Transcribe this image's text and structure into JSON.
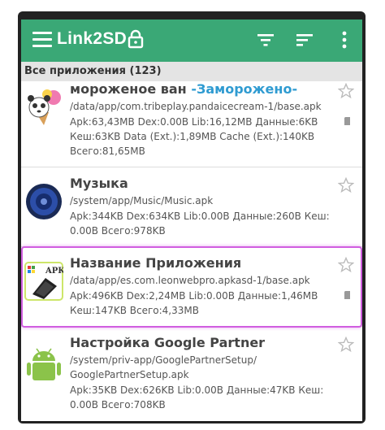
{
  "appbar": {
    "title": "Link2SD",
    "bg_color": "#3aa876"
  },
  "section": {
    "label": "Все приложения (123)"
  },
  "apps": [
    {
      "name": "мороженое ван",
      "frozen_tag": "-Заморожено-",
      "path": "/data/app/com.tribeplay.pandaicecream-1/base.apk",
      "line1": "Apk:63,43MB  Dex:0.00B  Lib:16,12MB  Данные:6KB",
      "line2": "Кеш:63KB  Data (Ext.):1,89MB  Cache (Ext.):140KB",
      "line3": "Всего:81,65MB",
      "icon": "panda-icecream-icon"
    },
    {
      "name": "Музыка",
      "path": "/system/app/Music/Music.apk",
      "line1": "Apk:344KB  Dex:634KB  Lib:0.00B  Данные:260B  Кеш:",
      "line2": "0.00B  Всего:978KB",
      "icon": "speaker-icon"
    },
    {
      "name": "Название Приложения",
      "path": "/data/app/es.com.leonwebpro.apkasd-1/base.apk",
      "line1": "Apk:496KB  Dex:2,24MB  Lib:0.00B  Данные:1,46MB",
      "line2": "Кеш:147KB  Всего:4,33MB",
      "icon": "apk-sdcard-icon",
      "icon_text": "APK"
    },
    {
      "name": "Настройка Google Partner",
      "path": "/system/priv-app/GooglePartnerSetup/",
      "path2": "GooglePartnerSetup.apk",
      "line1": "Apk:35KB  Dex:626KB  Lib:0.00B  Данные:47KB  Кеш:",
      "line2": "0.00B  Всего:708KB",
      "icon": "android-icon"
    }
  ]
}
